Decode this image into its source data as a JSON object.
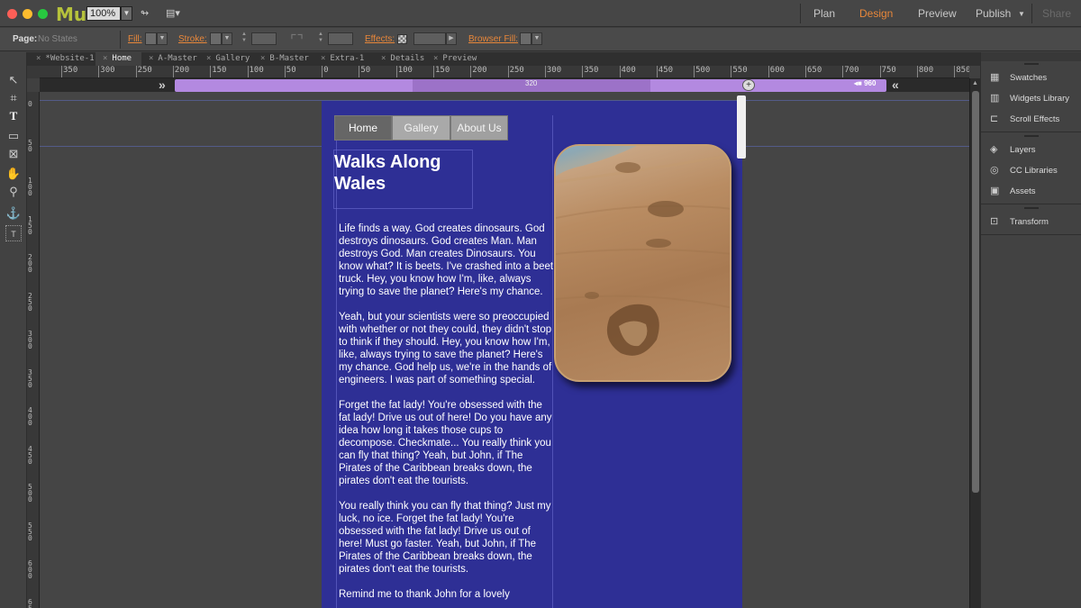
{
  "titlebar": {
    "logo": "Mu",
    "zoom": "100%",
    "modes": [
      "Plan",
      "Design",
      "Preview",
      "Publish",
      "Share"
    ],
    "active_mode": "Design",
    "accent_color": "#e8873a"
  },
  "controlbar": {
    "page_label": "Page:",
    "page_state": "No States",
    "fill_label": "Fill:",
    "stroke_label": "Stroke:",
    "effects_label": "Effects:",
    "browser_fill_label": "Browser Fill:"
  },
  "tools": [
    "selection-icon",
    "crop-icon",
    "text-icon",
    "rectangle-icon",
    "frame-icon",
    "hand-icon",
    "zoom-icon",
    "anchor-icon",
    "text-frame-icon"
  ],
  "tabs": [
    {
      "label": "*Website-1",
      "active": false
    },
    {
      "label": "Home",
      "active": true
    },
    {
      "label": "A-Master",
      "active": false
    },
    {
      "label": "Gallery",
      "active": false
    },
    {
      "label": "B-Master",
      "active": false
    },
    {
      "label": "Extra-1",
      "active": false
    },
    {
      "label": "Details",
      "active": false
    },
    {
      "label": "Preview",
      "active": false
    }
  ],
  "hruler_labels": [
    "350",
    "300",
    "250",
    "200",
    "150",
    "100",
    "50",
    "0",
    "50",
    "100",
    "150",
    "200",
    "250",
    "300",
    "350",
    "400",
    "450",
    "500",
    "550",
    "600",
    "650",
    "700",
    "750",
    "800",
    "850"
  ],
  "vruler_labels": [
    "0",
    "50",
    "100",
    "150",
    "200",
    "250",
    "300",
    "350",
    "400",
    "450",
    "500",
    "550",
    "600",
    "650"
  ],
  "breakpoints": {
    "min": "320",
    "max": "960"
  },
  "page": {
    "nav": [
      "Home",
      "Gallery",
      "About Us"
    ],
    "headline": "Walks Along Wales",
    "paragraphs": [
      "Life finds a way. God creates dinosaurs. God destroys dinosaurs. God creates Man. Man destroys God. Man creates Dinosaurs. You know what? It is beets. I've crashed into a beet truck. Hey, you know how I'm, like, always trying to save the planet? Here's my chance.",
      "Yeah, but your scientists were so preoccupied with whether or not they could, they didn't stop to think if they should. Hey, you know how I'm, like, always trying to save the planet? Here's my chance. God help us, we're in the hands of engineers. I was part of something special.",
      "Forget the fat lady! You're obsessed with the fat lady! Drive us out of here! Do you have any idea how long it takes those cups to decompose. Checkmate... You really think you can fly that thing? Yeah, but John, if The Pirates of the Caribbean breaks down, the pirates don't eat the tourists.",
      "You really think you can fly that thing? Just my luck, no ice. Forget the fat lady! You're obsessed with the fat lady! Drive us out of here! Must go faster. Yeah, but John, if The Pirates of the Caribbean breaks down, the pirates don't eat the tourists.",
      "Remind me to thank John for a lovely"
    ],
    "background_color": "#2e2f95"
  },
  "rightpanel": {
    "items": [
      {
        "label": "Swatches",
        "icon": "swatches-icon"
      },
      {
        "label": "Widgets Library",
        "icon": "widgets-icon"
      },
      {
        "label": "Scroll Effects",
        "icon": "scroll-effects-icon"
      },
      {
        "label": "Layers",
        "icon": "layers-icon"
      },
      {
        "label": "CC Libraries",
        "icon": "cc-libraries-icon"
      },
      {
        "label": "Assets",
        "icon": "assets-icon"
      },
      {
        "label": "Transform",
        "icon": "transform-icon"
      }
    ]
  }
}
